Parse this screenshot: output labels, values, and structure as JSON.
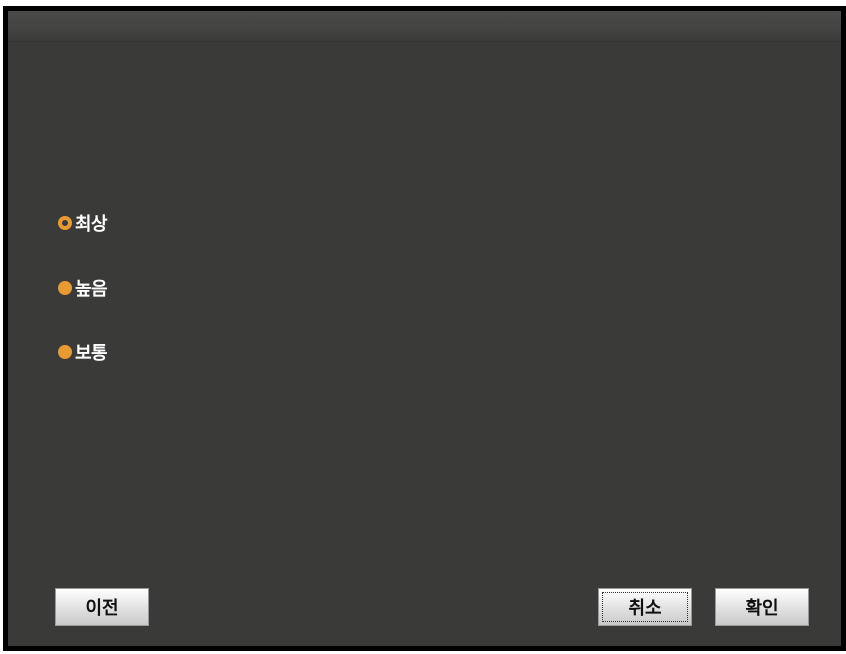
{
  "quality_options": [
    {
      "label": "최상",
      "selected": true
    },
    {
      "label": "높음",
      "selected": false
    },
    {
      "label": "보통",
      "selected": false
    }
  ],
  "buttons": {
    "previous_label": "이전",
    "cancel_label": "취소",
    "confirm_label": "확인"
  },
  "colors": {
    "accent": "#e89a34",
    "panel": "#3a3b39"
  }
}
